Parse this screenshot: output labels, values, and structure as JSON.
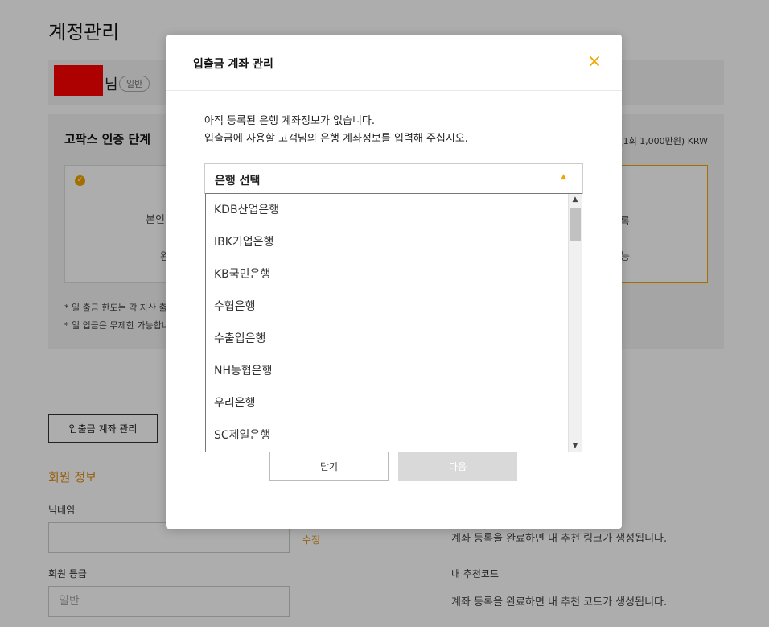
{
  "page": {
    "title": "계정관리",
    "user": {
      "suffix": "님",
      "badge": "일반"
    },
    "auth": {
      "title": "고팍스 인증 단계",
      "limit": "(1회 1,000만원) KRW",
      "step1_label": "본인",
      "step1_status": "완",
      "step_right_label": "록",
      "step_right_status": "능",
      "notes": [
        "* 일 출금 한도는 각 자산 출",
        "* 일 입금은 무제한 가능합니"
      ]
    },
    "account_button": "입출금 계좌 관리",
    "member": {
      "title": "회원 정보",
      "nickname_label": "닉네임",
      "edit_link": "수정",
      "grade_label": "회원 등급",
      "grade_value": "일반",
      "referral_link_msg": "계좌 등록을 완료하면 내 추천 링크가 생성됩니다.",
      "referral_code_label": "내 추천코드",
      "referral_code_msg": "계좌 등록을 완료하면 내 추천 코드가 생성됩니다."
    }
  },
  "modal": {
    "title": "입출금 계좌 관리",
    "close_icon": "×",
    "message_line1": "아직 등록된 은행 계좌정보가 없습니다.",
    "message_line2": "입출금에 사용할 고객님의 은행 계좌정보를 입력해 주십시오.",
    "select": {
      "value": "은행 선택",
      "arrow": "▲"
    },
    "buttons": {
      "close": "닫기",
      "next": "다음"
    },
    "bank_options": [
      "KDB산업은행",
      "IBK기업은행",
      "KB국민은행",
      "수협은행",
      "수출입은행",
      "NH농협은행",
      "우리은행",
      "SC제일은행"
    ]
  },
  "colors": {
    "accent": "#f0a500",
    "overlay": "rgba(0,0,0,0.32)"
  }
}
